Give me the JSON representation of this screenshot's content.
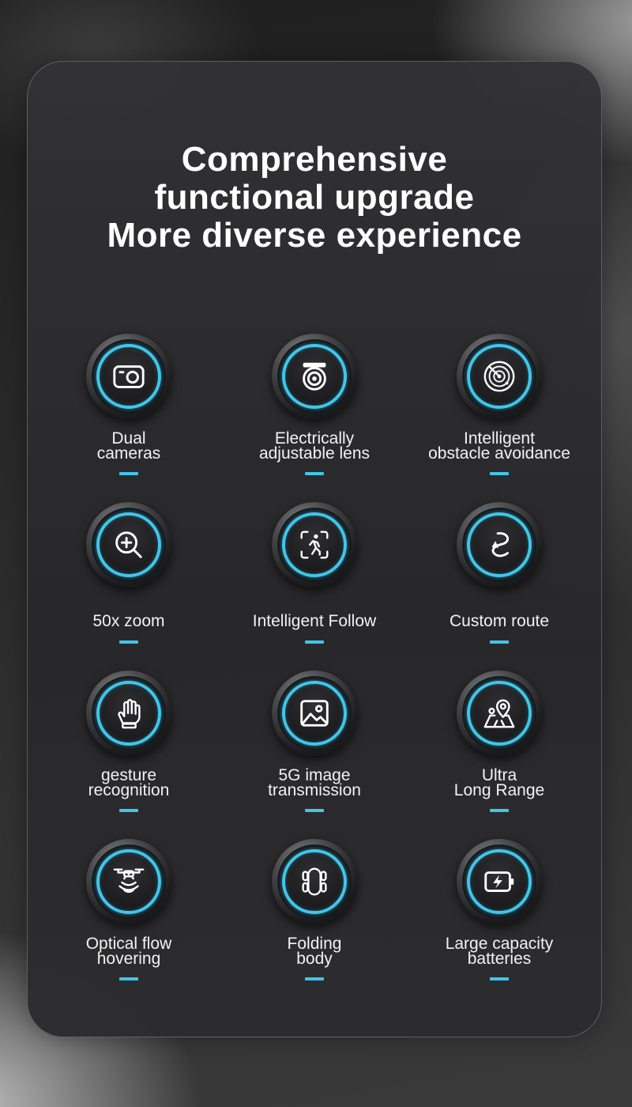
{
  "title": {
    "lines": [
      "Comprehensive",
      "functional upgrade",
      "More diverse experience"
    ]
  },
  "features": [
    {
      "label_lines": [
        "Dual",
        "cameras"
      ],
      "icon": "camera-icon"
    },
    {
      "label_lines": [
        "Electrically",
        "adjustable lens"
      ],
      "icon": "lens-icon"
    },
    {
      "label_lines": [
        "Intelligent",
        "obstacle avoidance"
      ],
      "icon": "radar-icon"
    },
    {
      "label_lines": [
        "50x zoom"
      ],
      "icon": "zoom-icon"
    },
    {
      "label_lines": [
        "Intelligent Follow"
      ],
      "icon": "follow-icon"
    },
    {
      "label_lines": [
        "Custom route"
      ],
      "icon": "route-icon"
    },
    {
      "label_lines": [
        "gesture",
        "recognition"
      ],
      "icon": "hand-gesture-icon"
    },
    {
      "label_lines": [
        "5G image",
        "transmission"
      ],
      "icon": "image-icon"
    },
    {
      "label_lines": [
        "Ultra",
        "Long Range"
      ],
      "icon": "map-pin-icon"
    },
    {
      "label_lines": [
        "Optical flow",
        "hovering"
      ],
      "icon": "drone-hover-icon"
    },
    {
      "label_lines": [
        "Folding",
        "body"
      ],
      "icon": "folding-drone-icon"
    },
    {
      "label_lines": [
        "Large capacity",
        "batteries"
      ],
      "icon": "battery-icon"
    }
  ],
  "colors": {
    "accent": "#3fc6ea",
    "text": "#ffffff",
    "card": "#2b2b2d"
  }
}
